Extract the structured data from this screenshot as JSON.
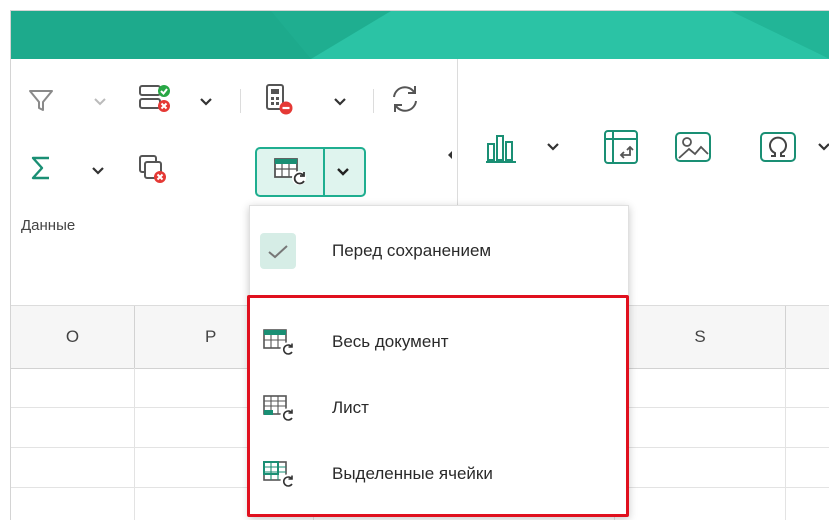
{
  "colors": {
    "accent": "#26b99a",
    "highlight": "#e0101e"
  },
  "ribbon": {
    "group_label": "Данные",
    "icons": [
      "filter-icon",
      "validation-icon",
      "sum-icon",
      "remove-duplicates-icon",
      "recalc-icon",
      "refresh-icon",
      "recalc-range-icon",
      "chart-icon",
      "pivot-icon",
      "image-icon",
      "symbol-icon"
    ]
  },
  "columns": [
    "O",
    "P",
    "",
    "",
    "S"
  ],
  "menu": {
    "items": [
      {
        "label": "Перед сохранением",
        "icon": "check-icon",
        "checked": true
      },
      {
        "label": "Весь документ",
        "icon": "recalc-document-icon"
      },
      {
        "label": "Лист",
        "icon": "recalc-sheet-icon"
      },
      {
        "label": "Выделенные ячейки",
        "icon": "recalc-selection-icon"
      }
    ]
  }
}
